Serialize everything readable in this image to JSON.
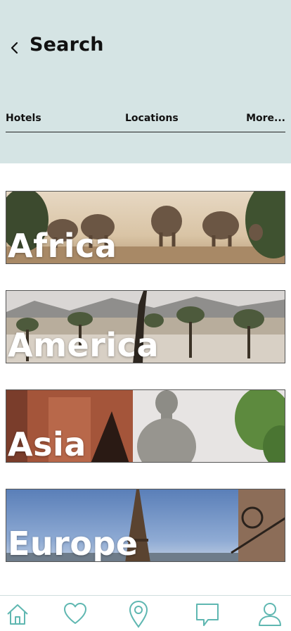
{
  "header": {
    "title": "Search",
    "back_icon": "chevron-left-icon",
    "background": "#d5e4e4"
  },
  "tabs": [
    {
      "label": "Hotels"
    },
    {
      "label": "Locations"
    },
    {
      "label": "More..."
    }
  ],
  "destinations": [
    {
      "label": "Africa",
      "image": "elephants-savanna"
    },
    {
      "label": "America",
      "image": "joshua-tree-desert"
    },
    {
      "label": "Asia",
      "image": "buddha-ruins"
    },
    {
      "label": "Europe",
      "image": "eiffel-tower"
    }
  ],
  "bottom_nav": [
    {
      "icon": "home-icon"
    },
    {
      "icon": "heart-icon"
    },
    {
      "icon": "location-pin-icon"
    },
    {
      "icon": "chat-icon"
    },
    {
      "icon": "user-icon"
    }
  ],
  "colors": {
    "accent": "#5fb7b1",
    "header_bg": "#d5e4e4"
  }
}
